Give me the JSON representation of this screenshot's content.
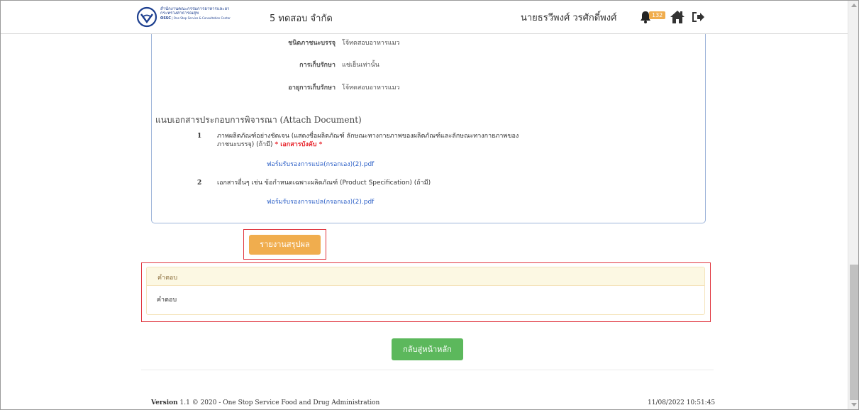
{
  "header": {
    "logo": {
      "line1": "สำนักงานคณะกรรมการอาหารและยา",
      "line2": "กระทรวงสาธารณสุข",
      "line3_bold": "OSSC",
      "line3": "| One Stop Service & Consultation Center"
    },
    "company": "5 ทดสอบ จำกัด",
    "user_name": "นายธรวีพงศ์ วรศักดิ์พงศ์",
    "notification_count": "132",
    "icons": [
      "bell-icon",
      "home-icon",
      "sign-out-icon"
    ]
  },
  "details": [
    {
      "label": "ชนิดภาชนะบรรจุ",
      "value": "โจ้ทดสอบอาหารแมว"
    },
    {
      "label": "การเก็บรักษา",
      "value": "แช่เย็นเท่านั้น"
    },
    {
      "label": "อายุการเก็บรักษา",
      "value": "โจ้ทดสอบอาหารแมว"
    }
  ],
  "attach": {
    "title_th": "แนบเอกสารประกอบการพิจารณา",
    "title_en": "(Attach Document)",
    "documents": [
      {
        "num": "1",
        "text_line1": "ภาพผลิตภัณฑ์อย่างชัดเจน (แสดงชื่อผลิตภัณฑ์ ลักษณะทางกายภาพของผลิตภัณฑ์และลักษณะทางกายภาพของ",
        "text_line2": "ภาชนะบรรจุ) (ถ้ามี)",
        "required_label": "* เอกสารบังคับ *",
        "file": "ฟอร์มรับรองการแปล(กรอกเอง)(2).pdf"
      },
      {
        "num": "2",
        "text_line1": "เอกสารอื่นๆ เช่น ข้อกำหนดเฉพาะผลิตภัณฑ์ (Product Specification) (ถ้ามี)",
        "file": "ฟอร์มรับรองการแปล(กรอกเอง)(2).pdf"
      }
    ]
  },
  "summary_button": "รายงานสรุปผล",
  "answer": {
    "heading": "คำตอบ",
    "body": "คำตอบ"
  },
  "back_button": "กลับสู่หน้าหลัก",
  "footer": {
    "version_label": "Version",
    "version_text": "1.1 © 2020 - One Stop Service Food and Drug Administration",
    "datetime": "11/08/2022 10:51:45"
  },
  "colors": {
    "accent_orange": "#f0ad4e",
    "accent_green": "#5cb85c",
    "highlight_red": "#e0363f",
    "link_blue": "#2f62c8",
    "panel_border": "#9db4d9"
  }
}
